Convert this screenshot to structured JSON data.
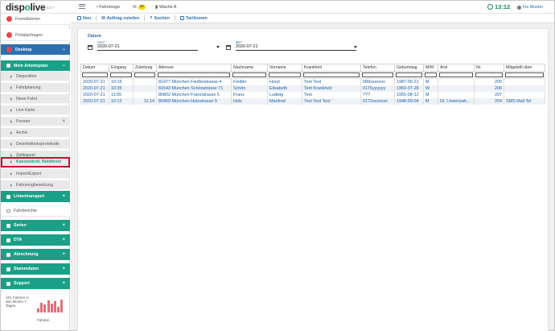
{
  "app": {
    "logo_text_a": "disp",
    "logo_text_b": "o",
    "logo_text_c": "live",
    "version": "v 4.0.7"
  },
  "topbar": {
    "vehicles": "• Fahrzeuge",
    "messages_count": "40",
    "station": "Wache A",
    "clock": "13:12",
    "user": "Iris Muster"
  },
  "sidebar": {
    "items": [
      {
        "label": "Fremdfahrten"
      },
      {
        "label": "Portalanfragen"
      },
      {
        "label": "Desktop",
        "sign": "−"
      },
      {
        "label": "Mein Arbeitsplatz",
        "sign": "−"
      },
      {
        "label": "Disposition"
      },
      {
        "label": "Fahrtplanung"
      },
      {
        "label": "Neue Fahrt"
      },
      {
        "label": "Live Karte"
      },
      {
        "label": "Fenster",
        "sign": "+"
      },
      {
        "label": "Archiv"
      },
      {
        "label": "Desinfektionsprotokolle"
      },
      {
        "label": "Zeitkapsel"
      },
      {
        "label": "Kassenärztl. Notdienst"
      },
      {
        "label": "Import/Export"
      },
      {
        "label": "Fahrzeugbesetzung"
      },
      {
        "label": "Linientransport",
        "sign": "+"
      },
      {
        "label": "Fahrberichte"
      },
      {
        "label": "Serien",
        "sign": "+"
      },
      {
        "label": "DTA",
        "sign": "+"
      },
      {
        "label": "Abrechnung",
        "sign": "+"
      },
      {
        "label": "Stammdaten",
        "sign": "+"
      },
      {
        "label": "Support",
        "sign": "+"
      }
    ],
    "stats_text": "101 Fahrten in den letzten 7 Tagen.",
    "stats_label": "Fahrten",
    "stats_bars": [
      0.25,
      0.55,
      0.45,
      0.7,
      0.5,
      0.65,
      0.3,
      0.75
    ]
  },
  "toolbar": {
    "new": "Neu",
    "assign": "Auftrag zuteilen",
    "search": "Suchen",
    "tariff": "Tarifzonen"
  },
  "filter": {
    "title": "Datum",
    "from_label": "Von*",
    "from_value": "2020-07-21",
    "to_label": "Bis*",
    "to_value": "2020-07-21"
  },
  "table": {
    "columns": [
      "Datum",
      "Eingang",
      "Zuteilung",
      "Adresse",
      "Nachname",
      "Vorname",
      "Krankheit",
      "Telefon",
      "Geburtstag",
      "M/W",
      "Arzt",
      "Nr.",
      "Mitgeteilt über"
    ],
    "rows": [
      [
        "2020-07-21",
        "10:15",
        "",
        "81477 München Fiedlerstrasse 4",
        "Fiedler",
        "Horst",
        "Text Text",
        "089xxxxxxx",
        "1987-05-21",
        "M",
        "",
        "205",
        ""
      ],
      [
        "2020-07-21",
        "10:35",
        "",
        "81543 München Schönstrasse 71",
        "Schön",
        "Elisabeth",
        "Text Krankheit",
        "0176yyyyyy",
        "1950-07-28",
        "W",
        "",
        "206",
        ""
      ],
      [
        "2020-07-21",
        "11:05",
        "",
        "80802 München Franzstrasse 5",
        "Franz",
        "Ludwig",
        "Text",
        "???",
        "1955-08-12",
        "M",
        "",
        "207",
        ""
      ],
      [
        "2020-07-21",
        "10:12",
        "11:14",
        "80469 München Holzstrasse 9",
        "Holz",
        "Manfred",
        "Text Text Text",
        "0172xxxxxxx",
        "1948-09-04",
        "M",
        "Dr. Löwenzah…",
        "204",
        "SMS Mail Tel"
      ]
    ]
  },
  "colors": {
    "accent_green": "#1aa086",
    "accent_blue": "#2e6fb0",
    "highlight_red": "#c8102e"
  }
}
